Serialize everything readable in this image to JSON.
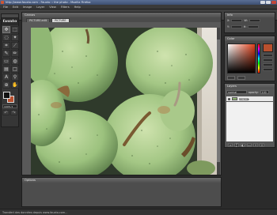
{
  "window": {
    "title": "http://www.fauxto.com - Fauxto :: the photo - Mozilla Firefox"
  },
  "menu": [
    "File",
    "Edit",
    "Image",
    "Layer",
    "View",
    "Filters",
    "Help"
  ],
  "app": {
    "logo_text": "fauxto"
  },
  "toolbox": {
    "tools": [
      "move-icon",
      "marquee-icon",
      "lasso-icon",
      "magic-wand-icon",
      "crop-icon",
      "slice-icon",
      "brush-icon",
      "pencil-icon",
      "eraser-icon",
      "fill-icon",
      "gradient-icon",
      "shape-icon",
      "text-icon",
      "dropper-icon",
      "zoom-icon",
      "hand-icon"
    ],
    "zoom_value": "100% ▾",
    "foreground_color": "#111111",
    "background_color": "#b8502e"
  },
  "canvas": {
    "title": "Canvas",
    "tabs": [
      "PICTURE.edit",
      "PICTURE"
    ],
    "active_tab": 1
  },
  "options_panel": {
    "title": "Options"
  },
  "info_panel": {
    "title": "Info",
    "labels": [
      "X:",
      "W:",
      "Y:",
      "H:"
    ]
  },
  "color_panel": {
    "title": "Color",
    "current_color": "#b8502e"
  },
  "layers_panel": {
    "title": "Layers",
    "blend_mode": "normal",
    "opacity_label": "opacity:",
    "opacity_value": "100",
    "layer_name": "PICTURE"
  },
  "status": {
    "text": "Transfert des données depuis www.fauxto.com..."
  }
}
